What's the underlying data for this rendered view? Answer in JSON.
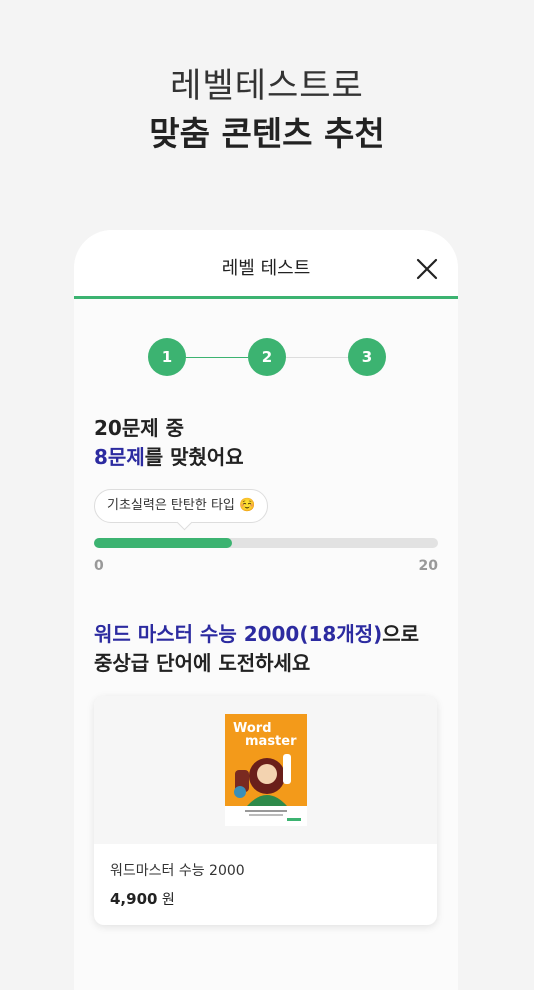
{
  "headline": {
    "line1": "레벨테스트로",
    "line2": "맞춤 콘텐츠 추천"
  },
  "modal": {
    "title": "레벨 테스트",
    "close_icon": "close-icon",
    "steps": [
      "1",
      "2",
      "3"
    ],
    "current_step": 2
  },
  "result": {
    "line1": "20문제 중",
    "correct": "8문제",
    "line2_rest": "를 맞췄어요"
  },
  "tooltip": {
    "text": "기초실력은 탄탄한 타입 ☺️"
  },
  "progress": {
    "value": 8,
    "max": 20,
    "min_label": "0",
    "max_label": "20"
  },
  "recommendation": {
    "book_title": "워드 마스터 수능 2000(18개정)",
    "line1_suffix": "으로",
    "line2": "중상급 단어에 도전하세요"
  },
  "product": {
    "cover_title_line1": "Word",
    "cover_title_line2": "master",
    "name": "워드마스터 수능 2000",
    "price": "4,900",
    "currency": "원"
  },
  "colors": {
    "accent": "#3cb371",
    "highlight": "#2c2ba0",
    "cover": "#f39a1a"
  }
}
